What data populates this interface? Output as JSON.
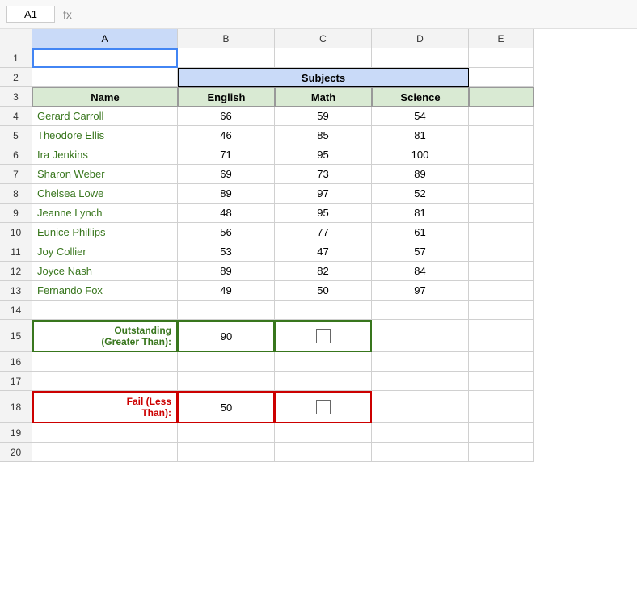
{
  "formula_bar": {
    "cell_ref": "A1",
    "formula_icon": "fx",
    "value": ""
  },
  "columns": {
    "a_label": "A",
    "b_label": "B",
    "c_label": "C",
    "d_label": "D",
    "e_label": "E"
  },
  "rows": {
    "numbers": [
      "1",
      "2",
      "3",
      "4",
      "5",
      "6",
      "7",
      "8",
      "9",
      "10",
      "11",
      "12",
      "13",
      "14",
      "15",
      "16",
      "17",
      "18",
      "19",
      "20"
    ]
  },
  "subjects_label": "Subjects",
  "headers": {
    "name": "Name",
    "english": "English",
    "math": "Math",
    "science": "Science"
  },
  "data": [
    {
      "name": "Gerard Carroll",
      "english": "66",
      "math": "59",
      "science": "54"
    },
    {
      "name": "Theodore Ellis",
      "english": "46",
      "math": "85",
      "science": "81"
    },
    {
      "name": "Ira Jenkins",
      "english": "71",
      "math": "95",
      "science": "100"
    },
    {
      "name": "Sharon Weber",
      "english": "69",
      "math": "73",
      "science": "89"
    },
    {
      "name": "Chelsea Lowe",
      "english": "89",
      "math": "97",
      "science": "52"
    },
    {
      "name": "Jeanne Lynch",
      "english": "48",
      "math": "95",
      "science": "81"
    },
    {
      "name": "Eunice Phillips",
      "english": "56",
      "math": "77",
      "science": "61"
    },
    {
      "name": "Joy Collier",
      "english": "53",
      "math": "47",
      "science": "57"
    },
    {
      "name": "Joyce Nash",
      "english": "89",
      "math": "82",
      "science": "84"
    },
    {
      "name": "Fernando Fox",
      "english": "49",
      "math": "50",
      "science": "97"
    }
  ],
  "outstanding": {
    "label": "Outstanding\n(Greater Than):",
    "value": "90"
  },
  "fail": {
    "label": "Fail (Less\nThan):",
    "value": "50"
  }
}
